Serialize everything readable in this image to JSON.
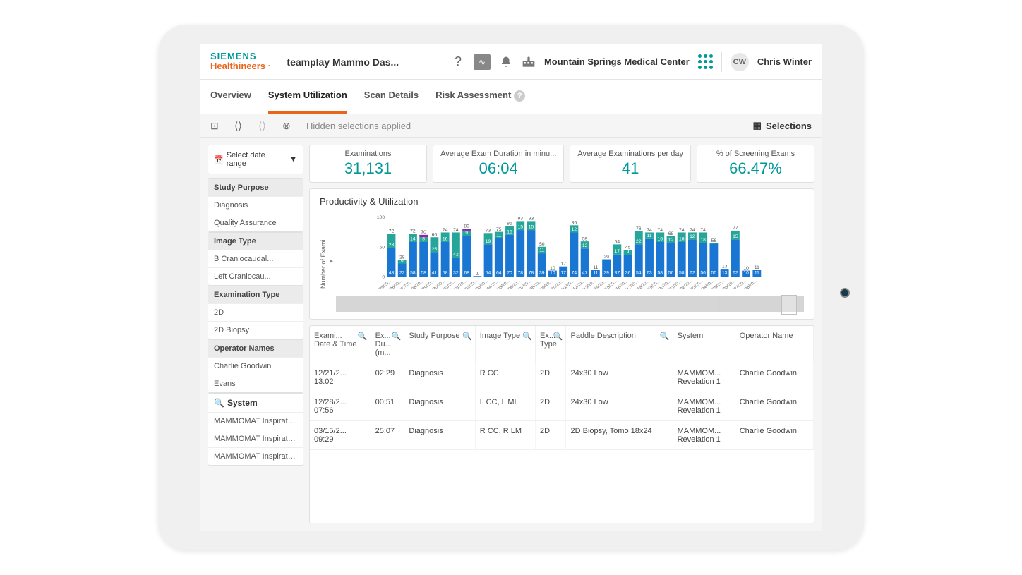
{
  "header": {
    "logo_line1": "SIEMENS",
    "logo_line2": "Healthineers",
    "app_title": "teamplay Mammo Das...",
    "location": "Mountain Springs Medical Center",
    "user_initials": "CW",
    "user_name": "Chris Winter"
  },
  "tabs": [
    {
      "label": "Overview",
      "active": false
    },
    {
      "label": "System Utilization",
      "active": true
    },
    {
      "label": "Scan Details",
      "active": false
    },
    {
      "label": "Risk Assessment",
      "active": false
    }
  ],
  "toolbar": {
    "hidden_text": "Hidden selections applied",
    "selections_label": "Selections"
  },
  "date_range_label": "Select date range",
  "kpis": [
    {
      "label": "Examinations",
      "value": "31,131"
    },
    {
      "label": "Average Exam Duration in minu...",
      "value": "06:04"
    },
    {
      "label": "Average Examinations per day",
      "value": "41"
    },
    {
      "label": "% of Screening Exams",
      "value": "66.47%"
    }
  ],
  "filters": [
    {
      "header": "Study Purpose",
      "items": [
        "Diagnosis",
        "Quality Assurance"
      ]
    },
    {
      "header": "Image Type",
      "items": [
        "B Craniocaudal...",
        "Left Craniocau..."
      ]
    },
    {
      "header": "Examination Type",
      "items": [
        "2D",
        "2D Biopsy"
      ]
    },
    {
      "header": "Operator Names",
      "items": [
        "Charlie Goodwin",
        "Evans"
      ]
    },
    {
      "header": "System",
      "search": true,
      "items": [
        "MAMMOMAT Inspiratio...",
        "MAMMOMAT Inspiratio...",
        "MAMMOMAT Inspiratio..."
      ]
    }
  ],
  "chart": {
    "title": "Productivity & Utilization",
    "ylabel": "Number of Exami..."
  },
  "chart_data": {
    "type": "bar",
    "title": "Productivity & Utilization",
    "ylabel": "Number of Exami...",
    "ylim": [
      0,
      100
    ],
    "categories": [
      "03/25/20...",
      "03/26/20...",
      "03/27/20...",
      "03/28/20...",
      "03/29/20...",
      "03/30/20...",
      "03/31/20...",
      "04/01/20...",
      "04/02/20...",
      "04/03/20...",
      "04/04/20...",
      "04/05/20...",
      "04/06/20...",
      "04/07/20...",
      "04/08/20...",
      "04/09/20...",
      "04/10/20...",
      "04/11/20...",
      "04/12/20...",
      "04/13/20...",
      "04/14/20...",
      "04/15/20...",
      "04/16/20...",
      "04/17/20...",
      "04/18/20...",
      "04/19/20...",
      "04/20/20...",
      "04/21/20...",
      "04/22/20...",
      "04/23/20...",
      "04/24/20...",
      "04/25/20...",
      "04/26/20...",
      "04/27/20...",
      "04/28/20..."
    ],
    "series": [
      {
        "name": "primary",
        "color": "#1976d2",
        "values": [
          48,
          22,
          58,
          58,
          41,
          58,
          32,
          68,
          1,
          54,
          64,
          70,
          78,
          78,
          39,
          10,
          17,
          74,
          47,
          11,
          29,
          37,
          36,
          54,
          63,
          58,
          56,
          58,
          62,
          56,
          55,
          13,
          62,
          10,
          11
        ]
      },
      {
        "name": "secondary",
        "color": "#26a69a",
        "values": [
          23,
          6,
          14,
          8,
          25,
          16,
          42,
          9,
          0,
          19,
          11,
          15,
          15,
          15,
          11,
          0,
          0,
          12,
          12,
          0,
          0,
          17,
          9,
          22,
          11,
          16,
          12,
          16,
          12,
          18,
          1,
          0,
          15,
          0,
          0
        ]
      },
      {
        "name": "tertiary",
        "color": "#8e24aa",
        "values": [
          1,
          0,
          0,
          4,
          0,
          0,
          0,
          3,
          0,
          0,
          0,
          0,
          0,
          0,
          0,
          0,
          0,
          0,
          0,
          0,
          0,
          0,
          0,
          0,
          0,
          0,
          0,
          0,
          0,
          0,
          0,
          0,
          0,
          0,
          0
        ]
      }
    ],
    "totals": [
      72,
      28,
      72,
      70,
      66,
      74,
      74,
      80,
      1,
      73,
      75,
      85,
      93,
      93,
      50,
      10,
      17,
      86,
      59,
      11,
      29,
      54,
      45,
      76,
      74,
      74,
      68,
      74,
      74,
      74,
      56,
      13,
      77,
      10,
      11
    ]
  },
  "table": {
    "columns": [
      "Exami... Date & Time",
      "Ex... Du... (m...",
      "Study Purpose",
      "Image Type",
      "Ex... Type",
      "Paddle Description",
      "System",
      "Operator Name"
    ],
    "rows": [
      [
        "12/21/2... 13:02",
        "02:29",
        "Diagnosis",
        "R CC",
        "2D",
        "24x30 Low",
        "MAMMOM... Revelation 1",
        "Charlie Goodwin"
      ],
      [
        "12/28/2... 07:56",
        "00:51",
        "Diagnosis",
        "L CC, L ML",
        "2D",
        "24x30 Low",
        "MAMMOM... Revelation 1",
        "Charlie Goodwin"
      ],
      [
        "03/15/2... 09:29",
        "25:07",
        "Diagnosis",
        "R CC, R LM",
        "2D",
        "2D Biopsy, Tomo 18x24",
        "MAMMOM... Revelation 1",
        "Charlie Goodwin"
      ]
    ]
  }
}
